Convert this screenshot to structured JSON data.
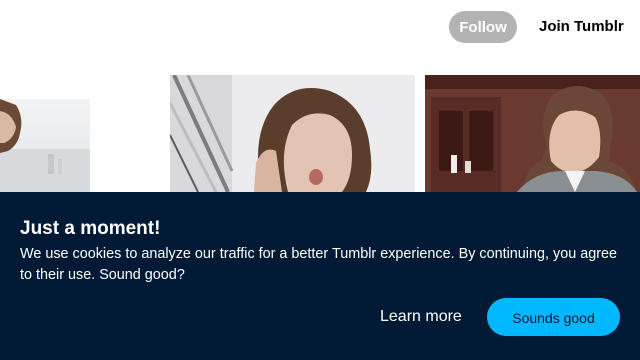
{
  "header": {
    "follow_label": "Follow",
    "join_label": "Join Tumblr"
  },
  "posts": [
    {
      "kind": "photo",
      "subject": "person portrait, overcast city background"
    },
    {
      "kind": "photo",
      "subject": "man on phone, building columns"
    },
    {
      "kind": "photo",
      "subject": "man in suit, wood-paneled room"
    }
  ],
  "cookie_banner": {
    "title": "Just a moment!",
    "message": "We use cookies to analyze our traffic for a better Tumblr experience. By continuing, you agree to their use. Sound good?",
    "learn_more_label": "Learn more",
    "accept_label": "Sounds good"
  },
  "colors": {
    "banner_bg": "#001935",
    "accept_button": "#00b8ff",
    "follow_button": "#b3b3b3"
  }
}
